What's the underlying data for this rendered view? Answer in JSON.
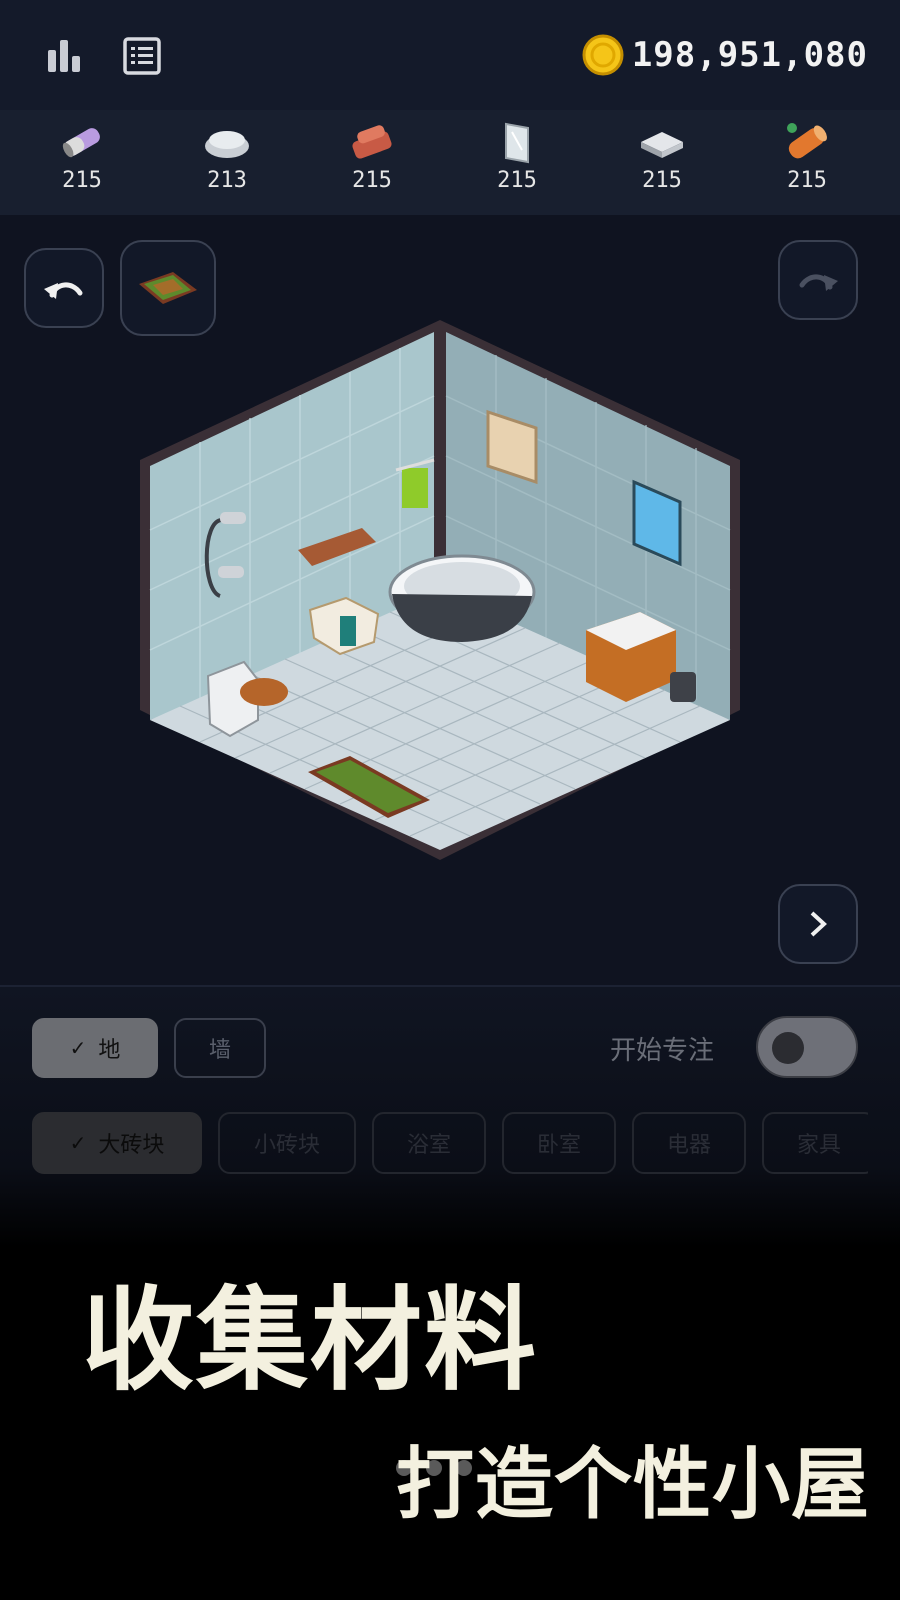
{
  "header": {
    "stats_icon": "bar-chart-icon",
    "list_icon": "list-icon",
    "coin_icon": "gold-coin-icon",
    "coins": "198,951,080"
  },
  "materials": [
    {
      "icon": "pipe-material-icon",
      "count": "215"
    },
    {
      "icon": "stone-material-icon",
      "count": "213"
    },
    {
      "icon": "brick-material-icon",
      "count": "215"
    },
    {
      "icon": "glass-material-icon",
      "count": "215"
    },
    {
      "icon": "metal-material-icon",
      "count": "215"
    },
    {
      "icon": "wood-material-icon",
      "count": "215"
    }
  ],
  "controls": {
    "undo_icon": "undo-icon",
    "selected_item_icon": "rug-icon",
    "redo_icon": "redo-icon",
    "next_icon": "chevron-right-icon"
  },
  "mode_tabs": {
    "floor": "地",
    "wall": "墙"
  },
  "focus": {
    "label": "开始专注",
    "enabled": false
  },
  "categories": [
    "大砖块",
    "小砖块",
    "浴室",
    "卧室",
    "电器",
    "家具"
  ],
  "promo": {
    "line1": "收集材料",
    "line2": "打造个性小屋"
  },
  "colors": {
    "background": "#0f1320",
    "coin": "#f5c518",
    "promo_text": "#f3f0df"
  }
}
